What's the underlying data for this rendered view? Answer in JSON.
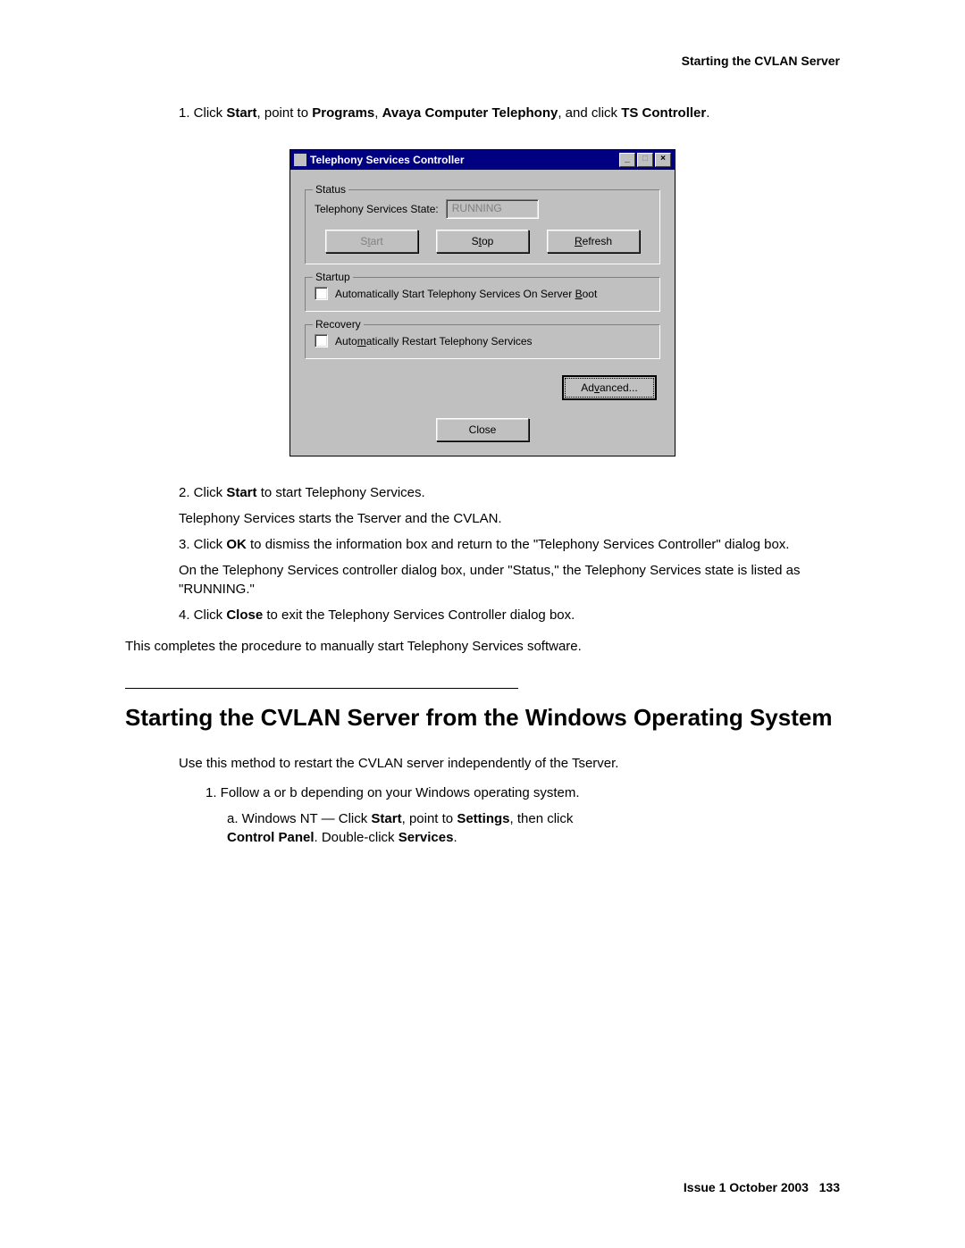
{
  "header": {
    "title": "Starting the CVLAN Server"
  },
  "steps_part1": {
    "s1_prefix": "1. Click ",
    "s1_b1": "Start",
    "s1_mid1": ", point to ",
    "s1_b2": "Programs",
    "s1_mid2": ", ",
    "s1_b3": "Avaya Computer Telephony",
    "s1_mid3": ", and click ",
    "s1_b4": "TS Controller",
    "s1_end": "."
  },
  "dialog": {
    "title": "Telephony Services Controller",
    "controls": {
      "minimize": "_",
      "maximize": "□",
      "close": "×"
    },
    "status_group": "Status",
    "state_label": "Telephony Services State:",
    "state_value": "RUNNING",
    "buttons": {
      "start_pre": "S",
      "start_u": "t",
      "start_post": "art",
      "stop_pre": "S",
      "stop_u": "t",
      "stop_post": "op",
      "refresh_pre": "",
      "refresh_u": "R",
      "refresh_post": "efresh",
      "advanced_pre": "Ad",
      "advanced_u": "v",
      "advanced_post": "anced...",
      "close": "Close"
    },
    "startup_group": "Startup",
    "startup_check_pre": "Automatically Start Telephony Services On Server ",
    "startup_check_u": "B",
    "startup_check_post": "oot",
    "recovery_group": "Recovery",
    "recovery_check_pre": "Auto",
    "recovery_check_u": "m",
    "recovery_check_post": "atically Restart Telephony Services"
  },
  "steps_part2": {
    "s2_prefix": "2. Click ",
    "s2_b": "Start",
    "s2_end": " to start Telephony Services.",
    "s2_sub": "Telephony Services starts the Tserver and the CVLAN.",
    "s3_prefix": "3. Click ",
    "s3_b": "OK",
    "s3_end": " to dismiss the information box and return to the \"Telephony Services Controller\" dialog box.",
    "s3_sub": "On the Telephony Services controller dialog box, under \"Status,\" the Telephony Services state is listed as \"RUNNING.\"",
    "s4_prefix": "4. Click ",
    "s4_b": "Close",
    "s4_end": " to exit the Telephony Services Controller dialog box.",
    "closing": "This completes the procedure to manually start Telephony Services software."
  },
  "section2": {
    "title": "Starting the CVLAN Server from the Windows Operating System",
    "intro": "Use this method to restart the CVLAN server independently of the Tserver.",
    "s1": "1. Follow a or b depending on your Windows operating system.",
    "a_prefix": "a. Windows NT — Click ",
    "a_b1": "Start",
    "a_mid1": ", point to ",
    "a_b2": "Settings",
    "a_mid2": ", then click ",
    "a_b3": "Control Panel",
    "a_mid3": ". Double-click ",
    "a_b4": "Services",
    "a_end": "."
  },
  "footer": {
    "issue": "Issue 1   October 2003",
    "page": "133"
  }
}
